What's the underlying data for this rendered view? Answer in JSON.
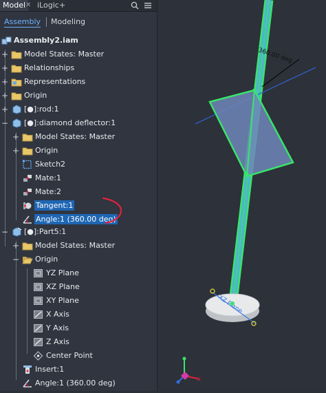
{
  "tabs": {
    "model": "Model",
    "ilogic": "iLogic",
    "add": "+"
  },
  "subtabs": {
    "assembly": "Assembly",
    "modeling": "Modeling"
  },
  "root": "Assembly2.iam",
  "items": [
    "Model States: Master",
    "Relationships",
    "Representations",
    "Origin",
    "[●]:rod:1",
    "[●]:diamond deflector:1",
    "Model States: Master",
    "Origin",
    "Sketch2",
    "Mate:1",
    "Mate:2",
    "Tangent:1",
    "Angle:1 (360.00 deg)",
    "[●]:Part5:1",
    "Model States: Master",
    "Origin",
    "YZ Plane",
    "XZ Plane",
    "XY Plane",
    "X Axis",
    "Y Axis",
    "Z Axis",
    "Center Point",
    "Insert:1",
    "Angle:1 (360.00 deg)"
  ],
  "viewport": {
    "angle_label": "360.00 deg",
    "plane_label": "XZ Plane"
  },
  "colors": {
    "highlight": "#1f66b3",
    "model_green": "#39e46a",
    "accent": "#6fb3ff",
    "annotation_red": "#e0223b"
  },
  "icons": [
    "search-icon",
    "menu-icon",
    "assembly-icon",
    "folder-icon",
    "part-icon",
    "sketch-icon",
    "mate-icon",
    "tangent-icon",
    "angle-icon",
    "plane-icon",
    "axis-icon",
    "point-icon",
    "insert-icon"
  ]
}
